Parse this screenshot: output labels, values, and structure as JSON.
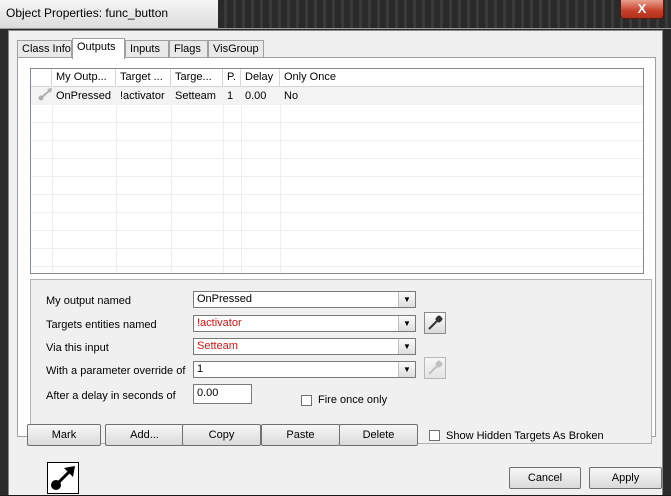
{
  "window": {
    "title": "Object Properties: func_button",
    "close_glyph": "X"
  },
  "tabs": [
    {
      "label": "Class Info",
      "active": false
    },
    {
      "label": "Outputs",
      "active": true
    },
    {
      "label": "Inputs",
      "active": false
    },
    {
      "label": "Flags",
      "active": false
    },
    {
      "label": "VisGroup",
      "active": false
    }
  ],
  "outputs_table": {
    "columns": [
      "My Outp...",
      "Target ...",
      "Targe...",
      "P.",
      "Delay",
      "Only Once"
    ],
    "rows": [
      {
        "icon": "output-connection-icon",
        "output": "OnPressed",
        "target": "!activator",
        "input": "Setteam",
        "param": "1",
        "delay": "0.00",
        "only_once": "No"
      }
    ]
  },
  "form": {
    "output_label": "My output named",
    "output_value": "OnPressed",
    "targets_label": "Targets entities named",
    "targets_value": "!activator",
    "input_label": "Via this input",
    "input_value": "Setteam",
    "param_label": "With a parameter override of",
    "param_value": "1",
    "delay_label": "After a delay in seconds of",
    "delay_value": "0.00",
    "fire_once_label": "Fire once only",
    "fire_once_checked": false,
    "invalid_color": "#d11111"
  },
  "buttons": {
    "mark": "Mark",
    "add": "Add...",
    "copy": "Copy",
    "paste": "Paste",
    "delete": "Delete",
    "show_hidden_label": "Show Hidden Targets As Broken",
    "show_hidden_checked": false
  },
  "footer": {
    "cancel": "Cancel",
    "apply": "Apply",
    "entity_icon": "entity-output-icon"
  }
}
